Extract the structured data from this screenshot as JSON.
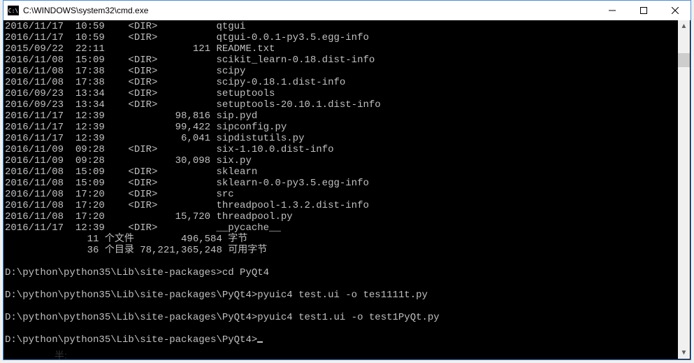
{
  "window": {
    "title": "C:\\WINDOWS\\system32\\cmd.exe",
    "icon_label": "C:\\"
  },
  "dir_entries": [
    {
      "date": "2016/11/17",
      "time": "10:59",
      "dir": true,
      "size": "",
      "name": "qtgui"
    },
    {
      "date": "2016/11/17",
      "time": "10:59",
      "dir": true,
      "size": "",
      "name": "qtgui-0.0.1-py3.5.egg-info"
    },
    {
      "date": "2015/09/22",
      "time": "22:11",
      "dir": false,
      "size": "121",
      "name": "README.txt"
    },
    {
      "date": "2016/11/08",
      "time": "15:09",
      "dir": true,
      "size": "",
      "name": "scikit_learn-0.18.dist-info"
    },
    {
      "date": "2016/11/08",
      "time": "17:38",
      "dir": true,
      "size": "",
      "name": "scipy"
    },
    {
      "date": "2016/11/08",
      "time": "17:38",
      "dir": true,
      "size": "",
      "name": "scipy-0.18.1.dist-info"
    },
    {
      "date": "2016/09/23",
      "time": "13:34",
      "dir": true,
      "size": "",
      "name": "setuptools"
    },
    {
      "date": "2016/09/23",
      "time": "13:34",
      "dir": true,
      "size": "",
      "name": "setuptools-20.10.1.dist-info"
    },
    {
      "date": "2016/11/17",
      "time": "12:39",
      "dir": false,
      "size": "98,816",
      "name": "sip.pyd"
    },
    {
      "date": "2016/11/17",
      "time": "12:39",
      "dir": false,
      "size": "99,422",
      "name": "sipconfig.py"
    },
    {
      "date": "2016/11/17",
      "time": "12:39",
      "dir": false,
      "size": "6,041",
      "name": "sipdistutils.py"
    },
    {
      "date": "2016/11/09",
      "time": "09:28",
      "dir": true,
      "size": "",
      "name": "six-1.10.0.dist-info"
    },
    {
      "date": "2016/11/09",
      "time": "09:28",
      "dir": false,
      "size": "30,098",
      "name": "six.py"
    },
    {
      "date": "2016/11/08",
      "time": "15:09",
      "dir": true,
      "size": "",
      "name": "sklearn"
    },
    {
      "date": "2016/11/08",
      "time": "15:09",
      "dir": true,
      "size": "",
      "name": "sklearn-0.0-py3.5.egg-info"
    },
    {
      "date": "2016/11/08",
      "time": "17:20",
      "dir": true,
      "size": "",
      "name": "src"
    },
    {
      "date": "2016/11/08",
      "time": "17:20",
      "dir": true,
      "size": "",
      "name": "threadpool-1.3.2.dist-info"
    },
    {
      "date": "2016/11/08",
      "time": "17:20",
      "dir": false,
      "size": "15,720",
      "name": "threadpool.py"
    },
    {
      "date": "2016/11/17",
      "time": "12:39",
      "dir": true,
      "size": "",
      "name": "__pycache__"
    }
  ],
  "summary": {
    "files_line": "              11 个文件        496,584 字节",
    "dirs_line": "              36 个目录 78,221,365,248 可用字节"
  },
  "commands": [
    {
      "prompt": "D:\\python\\python35\\Lib\\site-packages>",
      "cmd": "cd PyQt4"
    },
    {
      "prompt": "D:\\python\\python35\\Lib\\site-packages\\PyQt4>",
      "cmd": "pyuic4 test.ui -o tes1111t.py"
    },
    {
      "prompt": "D:\\python\\python35\\Lib\\site-packages\\PyQt4>",
      "cmd": "pyuic4 test1.ui -o test1PyQt.py"
    },
    {
      "prompt": "D:\\python\\python35\\Lib\\site-packages\\PyQt4>",
      "cmd": ""
    }
  ],
  "ime": "半:"
}
